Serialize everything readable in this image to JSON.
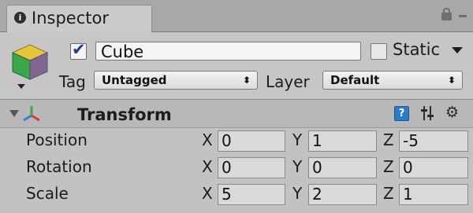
{
  "tab": {
    "label": "Inspector",
    "info_glyph": "i"
  },
  "header": {
    "active": true,
    "name": "Cube",
    "static_label": "Static",
    "static_checked": false,
    "tag_label": "Tag",
    "tag_value": "Untagged",
    "layer_label": "Layer",
    "layer_value": "Default",
    "dropdown_arrows": "⬍"
  },
  "transform": {
    "title": "Transform",
    "help_glyph": "?",
    "rows": [
      {
        "label": "Position",
        "x": "0",
        "y": "1",
        "z": "-5"
      },
      {
        "label": "Rotation",
        "x": "0",
        "y": "0",
        "z": "0"
      },
      {
        "label": "Scale",
        "x": "5",
        "y": "2",
        "z": "1"
      }
    ],
    "axis_labels": {
      "x": "X",
      "y": "Y",
      "z": "Z"
    }
  },
  "colors": {
    "cube_top": "#e6c53a",
    "cube_left": "#3ea64a",
    "cube_right": "#2f7fd6",
    "help_blue": "#2b7bc9"
  },
  "icons": {
    "lock": "lock-icon",
    "menu": "menu-icon",
    "gear": "gear-icon",
    "sliders": "sliders-icon",
    "transform": "transform-axes-icon",
    "cube": "cube-icon"
  }
}
